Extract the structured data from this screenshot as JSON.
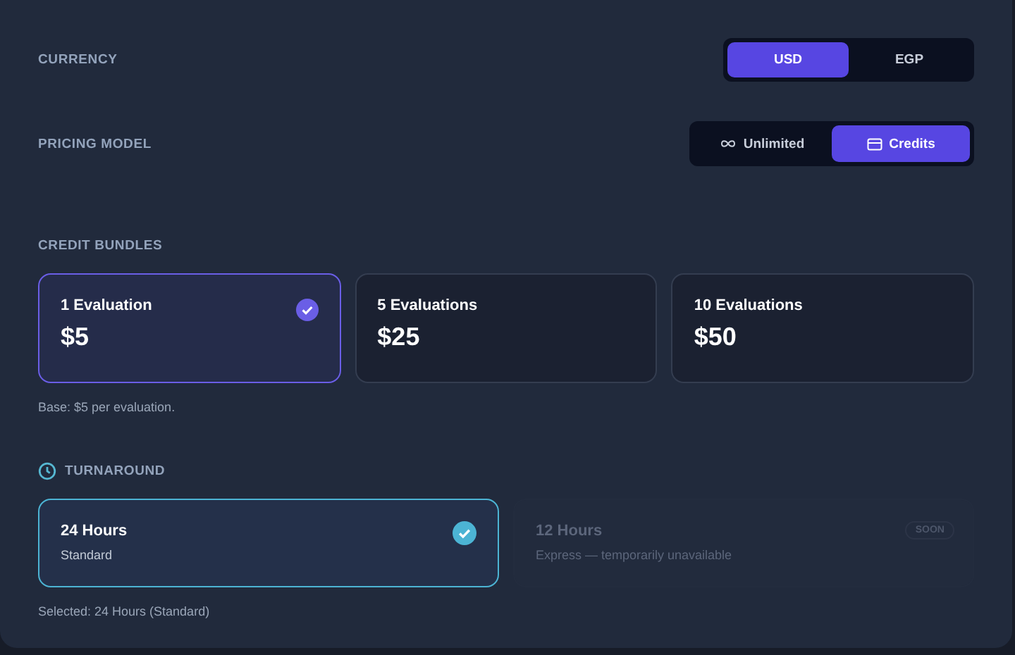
{
  "currency": {
    "label": "CURRENCY",
    "options": [
      {
        "label": "USD",
        "selected": true
      },
      {
        "label": "EGP",
        "selected": false
      }
    ]
  },
  "pricing_model": {
    "label": "PRICING MODEL",
    "options": [
      {
        "label": "Unlimited",
        "kind": "infinity",
        "selected": false
      },
      {
        "label": "Credits",
        "kind": "card",
        "selected": true
      }
    ]
  },
  "credit_bundles": {
    "label": "CREDIT BUNDLES",
    "bundles": [
      {
        "name": "1 Evaluation",
        "price": "$5",
        "selected": true
      },
      {
        "name": "5 Evaluations",
        "price": "$25",
        "selected": false
      },
      {
        "name": "10 Evaluations",
        "price": "$50",
        "selected": false
      }
    ],
    "note": "Base: $5 per evaluation."
  },
  "turnaround": {
    "label": "TURNAROUND",
    "options": [
      {
        "title": "24 Hours",
        "subtitle": "Standard",
        "selected": true,
        "disabled": false
      },
      {
        "title": "12 Hours",
        "subtitle": "Express — temporarily unavailable",
        "selected": false,
        "disabled": true,
        "badge": "SOON"
      }
    ],
    "summary": "Selected: 24 Hours (Standard)"
  }
}
